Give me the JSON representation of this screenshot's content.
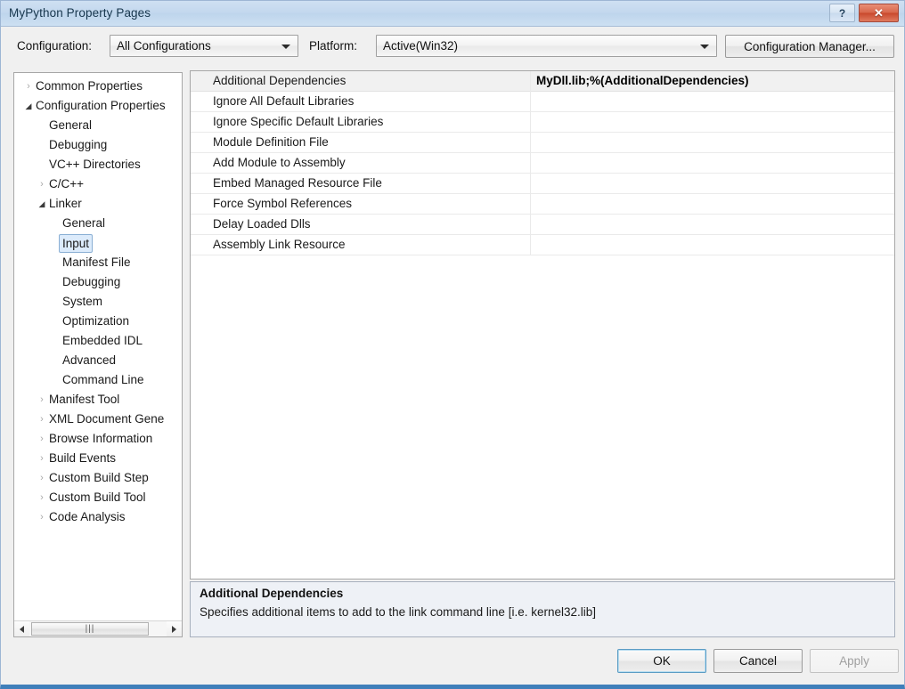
{
  "window": {
    "title": "MyPython Property Pages",
    "help_button": "?",
    "close_button": "✕"
  },
  "config_bar": {
    "configuration_label": "Configuration:",
    "configuration_value": "All Configurations",
    "platform_label": "Platform:",
    "platform_value": "Active(Win32)",
    "configuration_manager_button": "Configuration Manager..."
  },
  "tree": {
    "nodes": [
      {
        "label": "Common Properties",
        "indent": 0,
        "state": "collapsed",
        "selected": false
      },
      {
        "label": "Configuration Properties",
        "indent": 0,
        "state": "expanded",
        "selected": false
      },
      {
        "label": "General",
        "indent": 1,
        "state": "leaf",
        "selected": false
      },
      {
        "label": "Debugging",
        "indent": 1,
        "state": "leaf",
        "selected": false
      },
      {
        "label": "VC++ Directories",
        "indent": 1,
        "state": "leaf",
        "selected": false
      },
      {
        "label": "C/C++",
        "indent": 1,
        "state": "collapsed",
        "selected": false
      },
      {
        "label": "Linker",
        "indent": 1,
        "state": "expanded",
        "selected": false
      },
      {
        "label": "General",
        "indent": 2,
        "state": "leaf",
        "selected": false
      },
      {
        "label": "Input",
        "indent": 2,
        "state": "leaf",
        "selected": true
      },
      {
        "label": "Manifest File",
        "indent": 2,
        "state": "leaf",
        "selected": false
      },
      {
        "label": "Debugging",
        "indent": 2,
        "state": "leaf",
        "selected": false
      },
      {
        "label": "System",
        "indent": 2,
        "state": "leaf",
        "selected": false
      },
      {
        "label": "Optimization",
        "indent": 2,
        "state": "leaf",
        "selected": false
      },
      {
        "label": "Embedded IDL",
        "indent": 2,
        "state": "leaf",
        "selected": false
      },
      {
        "label": "Advanced",
        "indent": 2,
        "state": "leaf",
        "selected": false
      },
      {
        "label": "Command Line",
        "indent": 2,
        "state": "leaf",
        "selected": false
      },
      {
        "label": "Manifest Tool",
        "indent": 1,
        "state": "collapsed",
        "selected": false
      },
      {
        "label": "XML Document Gene",
        "indent": 1,
        "state": "collapsed",
        "selected": false
      },
      {
        "label": "Browse Information",
        "indent": 1,
        "state": "collapsed",
        "selected": false
      },
      {
        "label": "Build Events",
        "indent": 1,
        "state": "collapsed",
        "selected": false
      },
      {
        "label": "Custom Build Step",
        "indent": 1,
        "state": "collapsed",
        "selected": false
      },
      {
        "label": "Custom Build Tool",
        "indent": 1,
        "state": "collapsed",
        "selected": false
      },
      {
        "label": "Code Analysis",
        "indent": 1,
        "state": "collapsed",
        "selected": false
      }
    ],
    "scrollbar": {
      "left_arrow": "◀",
      "right_arrow": "▶",
      "thumb_grip": "|||"
    }
  },
  "property_grid": {
    "rows": [
      {
        "name": "Additional Dependencies",
        "value": "MyDll.lib;%(AdditionalDependencies)"
      },
      {
        "name": "Ignore All Default Libraries",
        "value": ""
      },
      {
        "name": "Ignore Specific Default Libraries",
        "value": ""
      },
      {
        "name": "Module Definition File",
        "value": ""
      },
      {
        "name": "Add Module to Assembly",
        "value": ""
      },
      {
        "name": "Embed Managed Resource File",
        "value": ""
      },
      {
        "name": "Force Symbol References",
        "value": ""
      },
      {
        "name": "Delay Loaded Dlls",
        "value": ""
      },
      {
        "name": "Assembly Link Resource",
        "value": ""
      }
    ]
  },
  "description": {
    "title": "Additional Dependencies",
    "text": "Specifies additional items to add to the link command line [i.e. kernel32.lib]"
  },
  "buttons": {
    "ok": "OK",
    "cancel": "Cancel",
    "apply": "Apply"
  },
  "colors": {
    "titlebar": "#c6daee",
    "close_button": "#d8674c",
    "selection": "#dcebfb",
    "description_bg": "#eef1f6",
    "window_edge": "#3f7fba"
  }
}
